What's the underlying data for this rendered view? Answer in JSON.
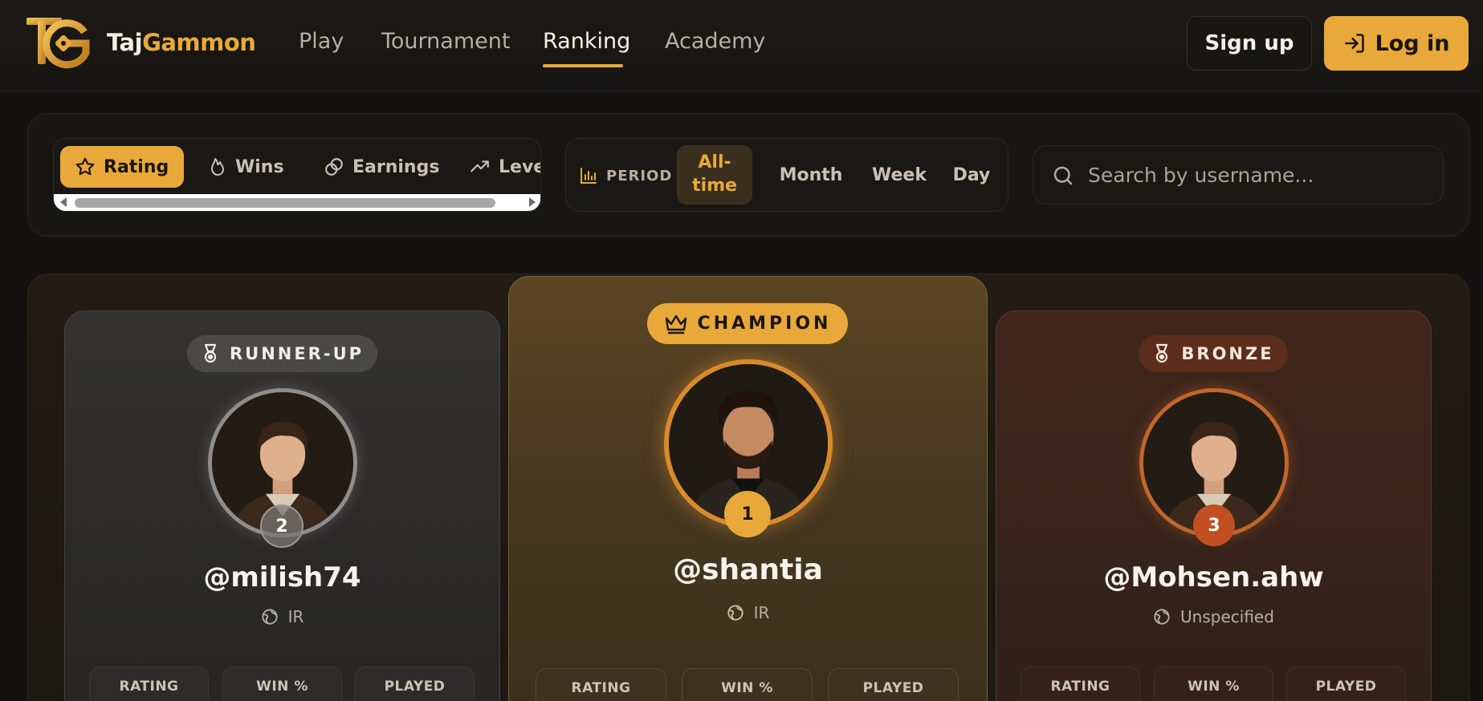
{
  "brand": {
    "part1": "Taj",
    "part2": "Gammon"
  },
  "nav": {
    "play": "Play",
    "tournament": "Tournament",
    "ranking": "Ranking",
    "academy": "Academy"
  },
  "auth": {
    "signup": "Sign up",
    "login": "Log in"
  },
  "metrics": {
    "rating": "Rating",
    "wins": "Wins",
    "earnings": "Earnings",
    "level": "Level",
    "active": "Rating"
  },
  "period": {
    "label": "PERIOD",
    "alltime": "All-time",
    "month": "Month",
    "week": "Week",
    "day": "Day",
    "active": "All-time"
  },
  "search": {
    "placeholder": "Search by username..."
  },
  "podium": {
    "second": {
      "badge": "RUNNER-UP",
      "rank": "2",
      "username": "@milish74",
      "country": "IR"
    },
    "first": {
      "badge": "CHAMPION",
      "rank": "1",
      "username": "@shantia",
      "country": "IR"
    },
    "third": {
      "badge": "BRONZE",
      "rank": "3",
      "username": "@Mohsen.ahw",
      "country": "Unspecified"
    }
  },
  "stats": {
    "rating": "RATING",
    "winpct": "WIN %",
    "played": "PLAYED"
  },
  "colors": {
    "accent": "#e9a93a",
    "background": "#141210",
    "silver": "#8f8e8c",
    "bronze": "#c2662b"
  }
}
